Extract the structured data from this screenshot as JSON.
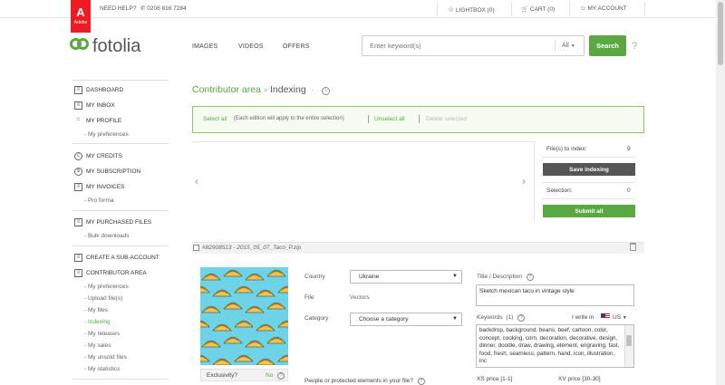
{
  "topbar": {
    "brand_letter": "A",
    "brand_text": "Adobe",
    "need_help": "NEED HELP?",
    "phone": "0208 816 7284",
    "lightbox": "LIGHTBOX (0)",
    "cart": "CART (0)",
    "account": "MY ACCOUNT"
  },
  "header": {
    "logo": "fotolia",
    "nav": [
      "IMAGES",
      "VIDEOS",
      "OFFERS"
    ],
    "search_placeholder": "Enter keyword(s)",
    "search_scope": "All",
    "search_button": "Search",
    "help": "?"
  },
  "sidebar": {
    "dashboard": "DASHBOARD",
    "inbox": "MY INBOX",
    "profile": "MY PROFILE",
    "profile_sub": "- My preferences",
    "credits": "MY CREDITS",
    "subscription": "MY SUBSCRIPTION",
    "invoices": "MY INVOICES",
    "invoices_sub": "- Pro forma",
    "purchased": "MY PURCHASED FILES",
    "purchased_sub": "- Bulk downloads",
    "subaccount": "CREATE A SUB-ACCOUNT",
    "contributor": "CONTRIBUTOR AREA",
    "contributor_items": [
      "- My preferences",
      "- Upload file(s)",
      "- My files",
      "- Indexing",
      "- My releases",
      "- My sales",
      "- My unsold files",
      "- My statistics"
    ]
  },
  "main": {
    "breadcrumb_root": "Contributor area",
    "breadcrumb_sep": ">",
    "breadcrumb_current": "Indexing",
    "breadcrumb_dash": "-",
    "selection": {
      "select_all": "Select all",
      "note": "(Each edition will apply to the entire selection)",
      "unselect_all": "Unselect all",
      "delete_selected": "Delete selected"
    },
    "panel": {
      "files_to_index_label": "File(s) to index:",
      "files_to_index_value": "9",
      "save_button": "Save indexing",
      "selection_label": "Selection:",
      "selection_value": "0",
      "submit_button": "Submit all"
    },
    "file": {
      "name": "#82908513 - 2015_05_07_Taco_P.zip",
      "exclusivity_label": "Exclusivity?",
      "exclusivity_value": "No",
      "country_label": "Country",
      "country_value": "Ukraine",
      "file_label": "File",
      "file_value": "Vectors",
      "category_label": "Category",
      "category_value": "Choose a category",
      "title_label": "Title / Description",
      "title_value": "Sketch mexican taco in vintage style",
      "keywords_label": "Keywords",
      "keywords_count": "(1)",
      "i_write_in": "I write in",
      "language": "US",
      "keywords_value": "backdrop, background, beans, beef, cartoon, color, concept, cooking, corn, decoration, decorative, design, dinner, doodle, draw, drawing, element, engraving, fast, food, fresh, seamless, pattern, hand, icon, illustration, inc",
      "people_question": "People or protected elements in your file?",
      "xs_price": "XS price [1-1]",
      "xv_price": "XV price [30-30]"
    }
  },
  "colors": {
    "accent": "#5aa840",
    "brand_red": "#ed1c24",
    "dark_button": "#555555"
  }
}
